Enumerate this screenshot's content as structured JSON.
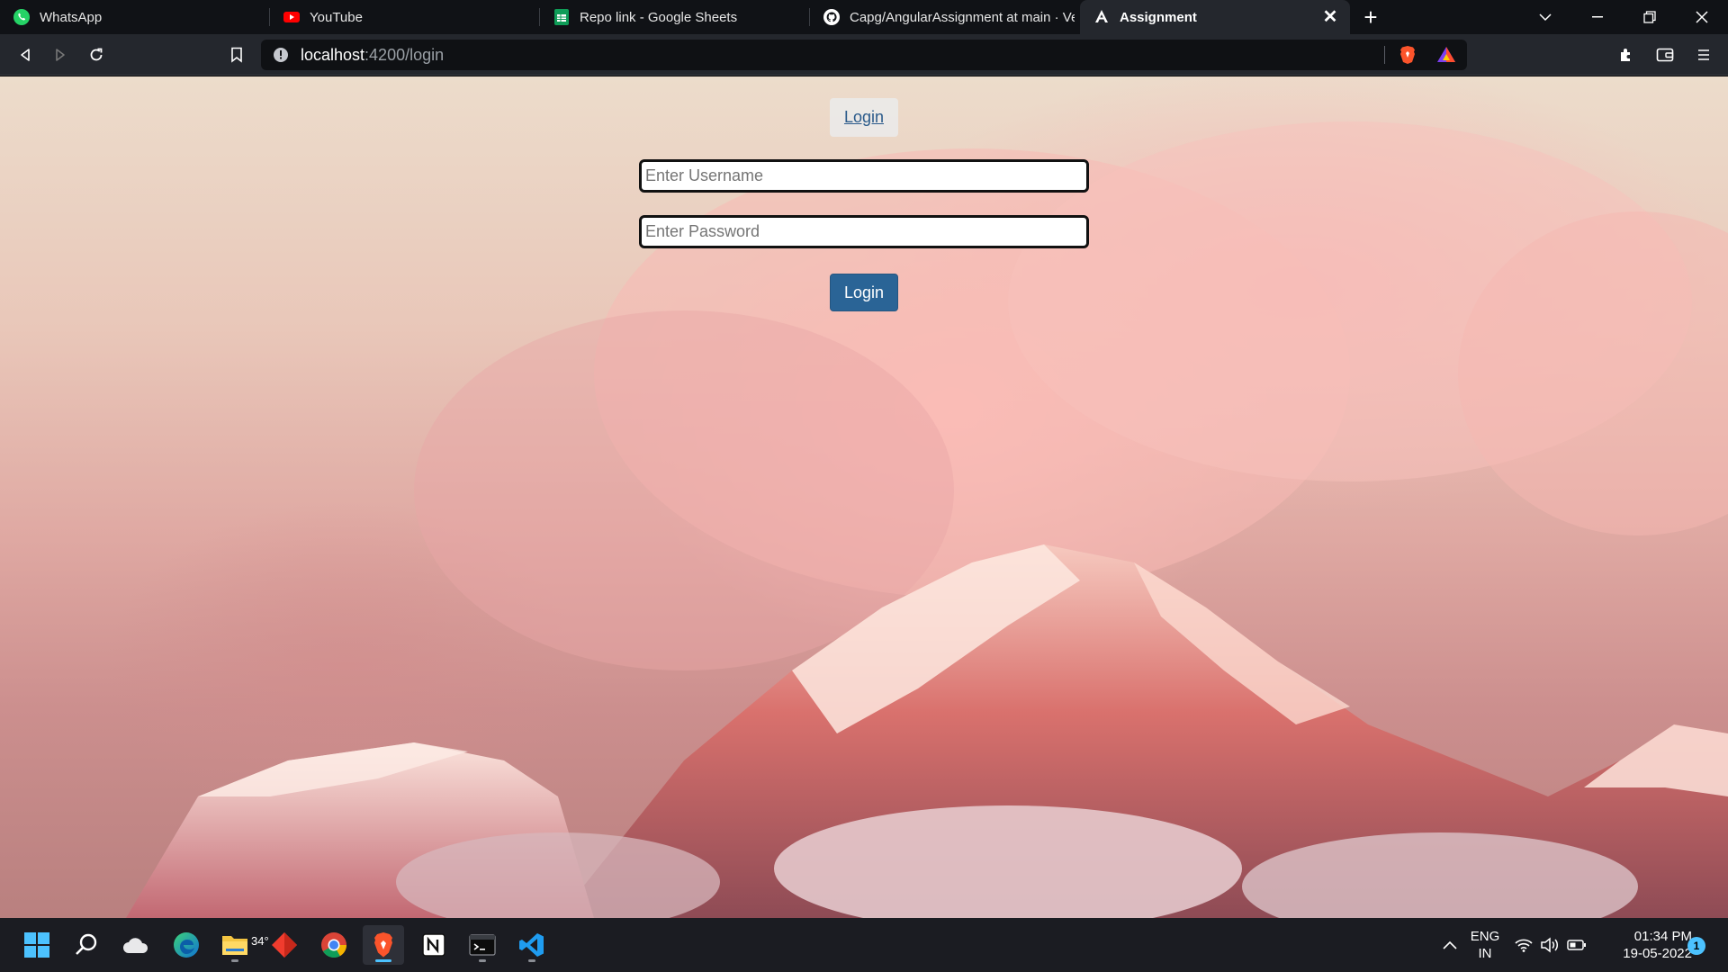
{
  "browser": {
    "tabs": [
      {
        "title": "WhatsApp",
        "icon": "whatsapp-icon",
        "active": false
      },
      {
        "title": "YouTube",
        "icon": "youtube-icon",
        "active": false
      },
      {
        "title": "Repo link - Google Sheets",
        "icon": "google-sheets-icon",
        "active": false
      },
      {
        "title": "Capg/AngularAssignment at main · Ve",
        "icon": "github-icon",
        "active": false
      },
      {
        "title": "Assignment",
        "icon": "angular-icon",
        "active": true
      }
    ],
    "close_tab_glyph": "✕",
    "new_tab_glyph": "+",
    "url": {
      "host": "localhost",
      "rest": ":4200/login"
    }
  },
  "page": {
    "nav_link_label": "Login",
    "username_placeholder": "Enter Username",
    "password_placeholder": "Enter Password",
    "username_value": "",
    "password_value": "",
    "submit_label": "Login"
  },
  "taskbar": {
    "weather_temp": "34°",
    "apps": [
      "start-icon",
      "search-icon",
      "weather-icon",
      "edge-icon",
      "file-explorer-icon",
      "git-icon",
      "chrome-icon",
      "brave-icon",
      "notion-icon",
      "terminal-icon",
      "vscode-icon"
    ],
    "lang_line1": "ENG",
    "lang_line2": "IN",
    "time": "01:34 PM",
    "date": "19-05-2022",
    "notification_count": "1"
  },
  "colors": {
    "accent": "#4cc2ff",
    "button_primary": "#2a6496",
    "tab_bg": "#101216",
    "toolbar_bg": "#24272d"
  }
}
